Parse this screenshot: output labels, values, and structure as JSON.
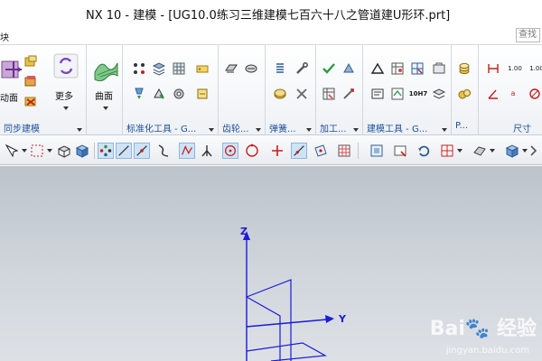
{
  "window": {
    "title": "NX 10 - 建模 - [UG10.0练习三维建模七百六十八之管道建U形环.prt]"
  },
  "menu": {
    "left_label": "块",
    "search_placeholder": "查找"
  },
  "ribbon": {
    "groups": [
      {
        "label": "同步建模"
      },
      {
        "label": ""
      },
      {
        "label": "标准化工具 - G..."
      },
      {
        "label": "齿轮..."
      },
      {
        "label": "弹簧..."
      },
      {
        "label": "加工..."
      },
      {
        "label": "建模工具 - G..."
      },
      {
        "label": "P..."
      },
      {
        "label": "尺寸"
      }
    ],
    "big_buttons": {
      "move_face": "动面",
      "more": "更多",
      "surface": "曲面"
    },
    "small_texts": {
      "v100a": "1.00",
      "v100b": "1.00",
      "h7": "10H7",
      "a1": "a",
      "a2": "a"
    }
  },
  "viewport": {
    "axes": {
      "z": "Z",
      "y": "Y"
    }
  },
  "watermark": {
    "main": "Bai🐾 经验",
    "sub": "jingyan.baidu.com"
  },
  "colors": {
    "axis_blue": "#1b1bd8",
    "ribbon_label_blue": "#1f4e9a"
  }
}
